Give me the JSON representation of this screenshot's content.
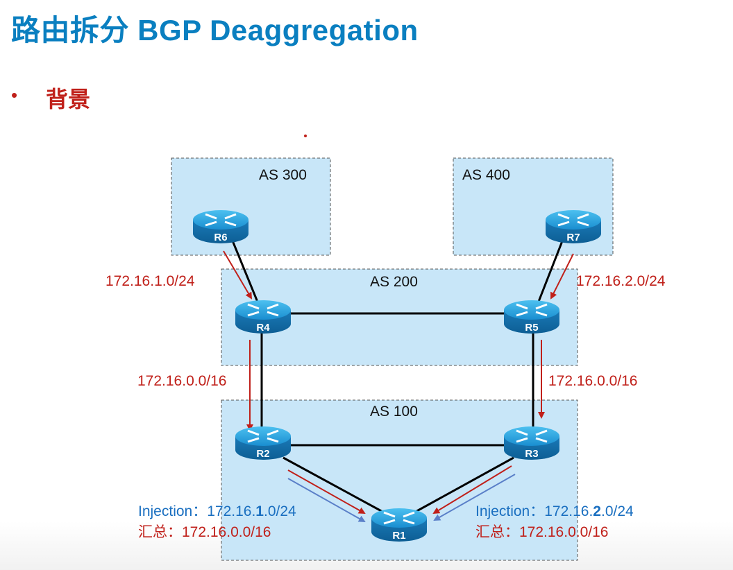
{
  "title": "路由拆分 BGP Deaggregation",
  "bullet": "背景",
  "colors": {
    "title": "#0a7fc0",
    "red": "#c0201a",
    "blue": "#1a6fc0",
    "as_box": "#c8e6f8"
  },
  "as_boxes": {
    "as300": "AS 300",
    "as400": "AS 400",
    "as200": "AS 200",
    "as100": "AS 100"
  },
  "routers": {
    "r1": "R1",
    "r2": "R2",
    "r3": "R3",
    "r4": "R4",
    "r5": "R5",
    "r6": "R6",
    "r7": "R7"
  },
  "routes": {
    "r6_to_r4": "172.16.1.0/24",
    "r7_to_r5": "172.16.2.0/24",
    "r4_to_r2": "172.16.0.0/16",
    "r5_to_r3": "172.16.0.0/16"
  },
  "left_note": {
    "injection_label": "Injection：",
    "injection_pre": "172.16.",
    "injection_bold": "1",
    "injection_post": ".0/24",
    "summary": "汇总：172.16.0.0/16"
  },
  "right_note": {
    "injection_label": "Injection：",
    "injection_pre": "172.16.",
    "injection_bold": "2",
    "injection_post": ".0/24",
    "summary": "汇总：172.16.0.0/16"
  }
}
